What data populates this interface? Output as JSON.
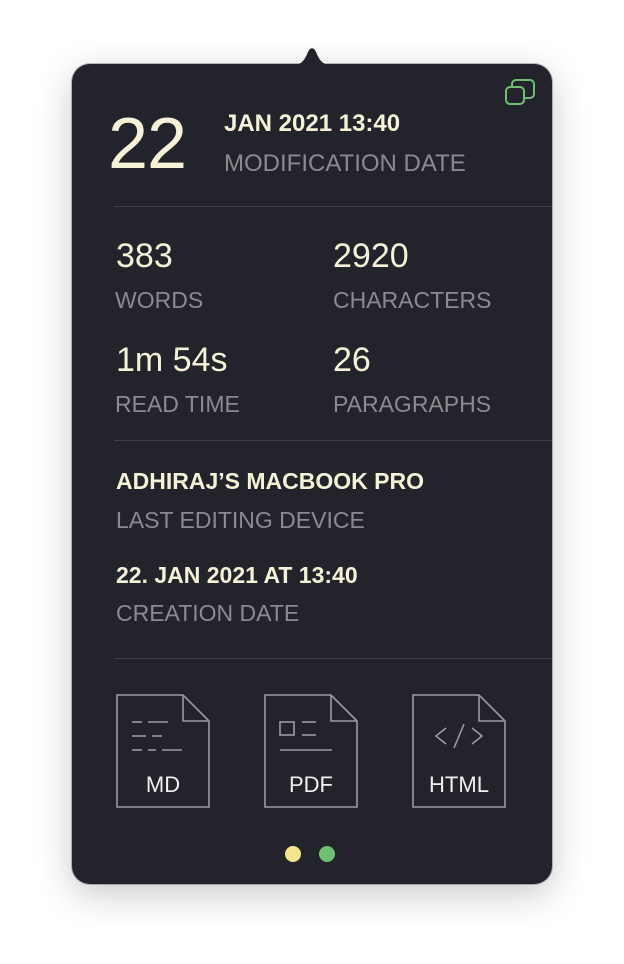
{
  "header": {
    "day": "22",
    "month_year_time": "JAN 2021 13:40",
    "date_label": "MODIFICATION DATE"
  },
  "stats": {
    "words": {
      "value": "383",
      "label": "WORDS"
    },
    "characters": {
      "value": "2920",
      "label": "CHARACTERS"
    },
    "read_time": {
      "value": "1m 54s",
      "label": "READ TIME"
    },
    "paragraphs": {
      "value": "26",
      "label": "PARAGRAPHS"
    }
  },
  "device": {
    "value": "ADHIRAJ’S MACBOOK PRO",
    "label": "LAST EDITING DEVICE"
  },
  "creation": {
    "value": "22. JAN 2021 AT 13:40",
    "label": "CREATION DATE"
  },
  "exports": [
    {
      "label": "MD",
      "icon": "markdown-file-icon"
    },
    {
      "label": "PDF",
      "icon": "pdf-file-icon"
    },
    {
      "label": "HTML",
      "icon": "html-file-icon"
    }
  ],
  "page_dots": [
    {
      "color": "#f3e58a",
      "active": true
    },
    {
      "color": "#6fbf73",
      "active": false
    }
  ],
  "colors": {
    "background": "#23242b",
    "primary_text": "#f5f2d8",
    "secondary_text": "#8a8b90",
    "copy_icon": "#6fbf73"
  }
}
